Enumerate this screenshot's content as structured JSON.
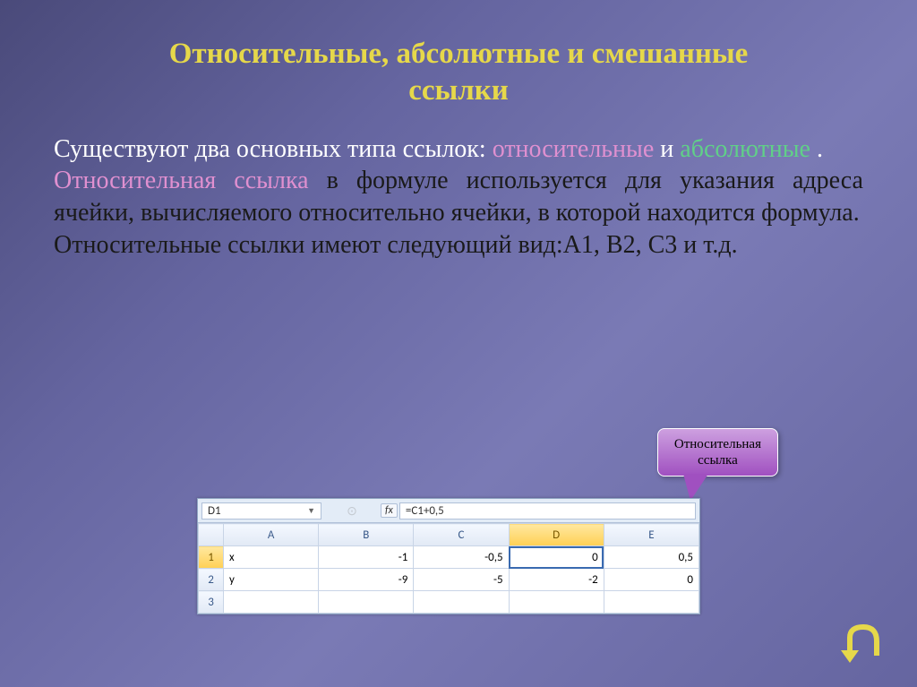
{
  "title_line1": "Относительные, абсолютные и  смешанные",
  "title_line2": "ссылки",
  "body": {
    "p1_a": "Существуют два основных типа ссылок: ",
    "p1_rel": "относительные",
    "p1_and": " и ",
    "p1_abs": "абсолютные",
    "p1_dot": ".",
    "p2_lead": "Относительная ссылка",
    "p2_rest": " в формуле используется для указания адреса ячейки, вычисляемого относительно ячейки, в которой находится формула.",
    "p3": "Относительные ссылки имеют следующий вид:A1, B2, C3 и т.д."
  },
  "callout": {
    "line1": "Относительная",
    "line2": "ссылка"
  },
  "excel": {
    "name_box": "D1",
    "fx_label": "fx",
    "formula": "=C1+0,5",
    "cols": [
      "A",
      "B",
      "C",
      "D",
      "E"
    ],
    "rows": [
      {
        "num": "1",
        "cells": [
          "x",
          "-1",
          "-0,5",
          "0",
          "0,5"
        ]
      },
      {
        "num": "2",
        "cells": [
          "y",
          "-9",
          "-5",
          "-2",
          "0"
        ]
      },
      {
        "num": "3",
        "cells": [
          "",
          "",
          "",
          "",
          ""
        ]
      }
    ],
    "selected_col_index": 3,
    "selected_row_index": 0
  },
  "nav": {
    "back": "back"
  }
}
